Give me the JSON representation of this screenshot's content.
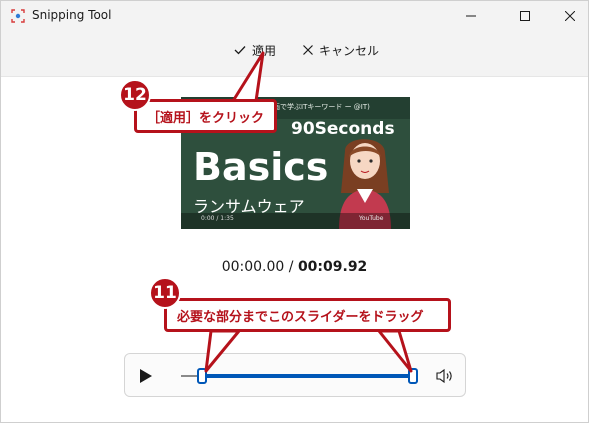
{
  "window": {
    "title": "Snipping Tool"
  },
  "toolbar": {
    "apply_label": "適用",
    "cancel_label": "キャンセル"
  },
  "thumbnail": {
    "subtitle": "動画で学ぶITキーワード ー @IT)",
    "heading": "90Seconds",
    "main": "Basics",
    "sub_jp": "ランサムウェア",
    "time": "0:00 / 1:35",
    "logo": "YouTube"
  },
  "timeline": {
    "current": "00:00.00",
    "separator": "/",
    "total": "00:09.92"
  },
  "callouts": {
    "apply": {
      "number": "12",
      "text": "［適用］をクリック"
    },
    "slider": {
      "number": "11",
      "text": "必要な部分までこのスライダーをドラッグ"
    }
  },
  "colors": {
    "accent": "#0057b7",
    "callout": "#b5121b",
    "chalkboard": "#2e4f3d"
  },
  "icons": [
    "app-icon",
    "minimize-icon",
    "maximize-icon",
    "close-icon",
    "checkmark-icon",
    "x-icon",
    "play-icon",
    "volume-icon"
  ]
}
